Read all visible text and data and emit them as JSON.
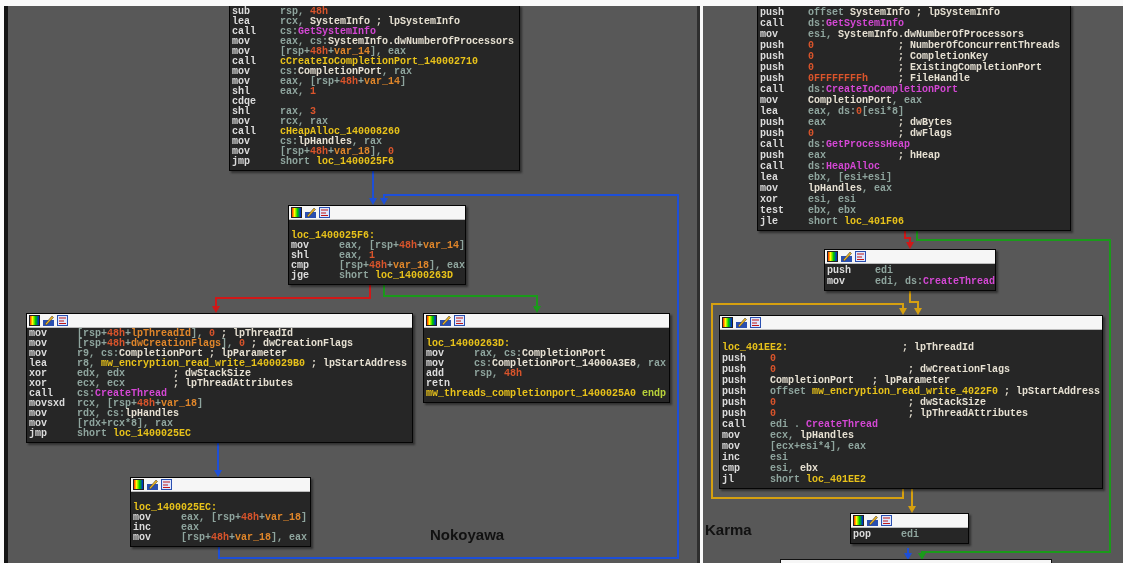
{
  "panels": [
    {
      "title": "Nokoyawa",
      "nodes": [
        {
          "header": false,
          "blank_line": false,
          "lines": [
            {
              "op": "sub",
              "args": [
                {
                  "text": "rsp, ",
                  "kind": "reg"
                },
                {
                  "text": "48h",
                  "kind": "num"
                }
              ]
            },
            {
              "op": "lea",
              "args": [
                {
                  "text": "rcx, ",
                  "kind": "reg"
                },
                {
                  "text": "SystemInfo ; lpSystemInfo",
                  "kind": "name"
                }
              ]
            },
            {
              "op": "call",
              "args": [
                {
                  "text": "cs:",
                  "kind": "reg"
                },
                {
                  "text": "GetSystemInfo",
                  "kind": "func"
                }
              ]
            },
            {
              "op": "mov",
              "args": [
                {
                  "text": "eax, cs:",
                  "kind": "reg"
                },
                {
                  "text": "SystemInfo.dwNumberOfProcessors",
                  "kind": "name"
                }
              ]
            },
            {
              "op": "mov",
              "args": [
                {
                  "text": "[rsp+",
                  "kind": "reg"
                },
                {
                  "text": "48h",
                  "kind": "num"
                },
                {
                  "text": "+",
                  "kind": "reg"
                },
                {
                  "text": "var_14",
                  "kind": "var"
                },
                {
                  "text": "], eax",
                  "kind": "reg"
                }
              ]
            },
            {
              "op": "call",
              "args": [
                {
                  "text": "cCreateIoCompletionPort_140002710",
                  "kind": "label"
                }
              ]
            },
            {
              "op": "mov",
              "args": [
                {
                  "text": "cs:",
                  "kind": "reg"
                },
                {
                  "text": "CompletionPort",
                  "kind": "name"
                },
                {
                  "text": ", rax",
                  "kind": "reg"
                }
              ]
            },
            {
              "op": "mov",
              "args": [
                {
                  "text": "eax, [rsp+",
                  "kind": "reg"
                },
                {
                  "text": "48h",
                  "kind": "num"
                },
                {
                  "text": "+",
                  "kind": "reg"
                },
                {
                  "text": "var_14",
                  "kind": "var"
                },
                {
                  "text": "]",
                  "kind": "reg"
                }
              ]
            },
            {
              "op": "shl",
              "args": [
                {
                  "text": "eax, ",
                  "kind": "reg"
                },
                {
                  "text": "1",
                  "kind": "num"
                }
              ]
            },
            {
              "op": "cdqe"
            },
            {
              "op": "shl",
              "args": [
                {
                  "text": "rax, ",
                  "kind": "reg"
                },
                {
                  "text": "3",
                  "kind": "num"
                }
              ]
            },
            {
              "op": "mov",
              "args": [
                {
                  "text": "rcx, rax",
                  "kind": "reg"
                }
              ]
            },
            {
              "op": "call",
              "args": [
                {
                  "text": "cHeapAlloc_140008260",
                  "kind": "label"
                }
              ]
            },
            {
              "op": "mov",
              "args": [
                {
                  "text": "cs:",
                  "kind": "reg"
                },
                {
                  "text": "lpHandles",
                  "kind": "name"
                },
                {
                  "text": ", rax",
                  "kind": "reg"
                }
              ]
            },
            {
              "op": "mov",
              "args": [
                {
                  "text": "[rsp+",
                  "kind": "reg"
                },
                {
                  "text": "48h",
                  "kind": "num"
                },
                {
                  "text": "+",
                  "kind": "reg"
                },
                {
                  "text": "var_18",
                  "kind": "var"
                },
                {
                  "text": "], ",
                  "kind": "reg"
                },
                {
                  "text": "0",
                  "kind": "num"
                }
              ]
            },
            {
              "op": "jmp",
              "args": [
                {
                  "text": "short ",
                  "kind": "reg"
                },
                {
                  "text": "loc_1400025F6",
                  "kind": "label"
                }
              ]
            }
          ]
        },
        {
          "header": true,
          "blank_line": true,
          "lines": [
            {
              "args": [
                {
                  "text": "loc_1400025F6:",
                  "kind": "label"
                }
              ]
            },
            {
              "op": "mov",
              "args": [
                {
                  "text": "eax, [rsp+",
                  "kind": "reg"
                },
                {
                  "text": "48h",
                  "kind": "num"
                },
                {
                  "text": "+",
                  "kind": "reg"
                },
                {
                  "text": "var_14",
                  "kind": "var"
                },
                {
                  "text": "]",
                  "kind": "reg"
                }
              ]
            },
            {
              "op": "shl",
              "args": [
                {
                  "text": "eax, ",
                  "kind": "reg"
                },
                {
                  "text": "1",
                  "kind": "num"
                }
              ]
            },
            {
              "op": "cmp",
              "args": [
                {
                  "text": "[rsp+",
                  "kind": "reg"
                },
                {
                  "text": "48h",
                  "kind": "num"
                },
                {
                  "text": "+",
                  "kind": "reg"
                },
                {
                  "text": "var_18",
                  "kind": "var"
                },
                {
                  "text": "], eax",
                  "kind": "reg"
                }
              ]
            },
            {
              "op": "jge",
              "args": [
                {
                  "text": "short ",
                  "kind": "reg"
                },
                {
                  "text": "loc_14000263D",
                  "kind": "label"
                }
              ]
            }
          ]
        },
        {
          "header": true,
          "blank_line": false,
          "lines": [
            {
              "op": "mov",
              "args": [
                {
                  "text": "[rsp+",
                  "kind": "reg"
                },
                {
                  "text": "48h",
                  "kind": "num"
                },
                {
                  "text": "+",
                  "kind": "reg"
                },
                {
                  "text": "lpThreadId",
                  "kind": "var"
                },
                {
                  "text": "], ",
                  "kind": "reg"
                },
                {
                  "text": "0",
                  "kind": "num"
                },
                {
                  "text": " ; lpThreadId",
                  "kind": "name"
                }
              ]
            },
            {
              "op": "mov",
              "args": [
                {
                  "text": "[rsp+",
                  "kind": "reg"
                },
                {
                  "text": "48h",
                  "kind": "num"
                },
                {
                  "text": "+",
                  "kind": "reg"
                },
                {
                  "text": "dwCreationFlags",
                  "kind": "var"
                },
                {
                  "text": "], ",
                  "kind": "reg"
                },
                {
                  "text": "0",
                  "kind": "num"
                },
                {
                  "text": " ; dwCreationFlags",
                  "kind": "name"
                }
              ]
            },
            {
              "op": "mov",
              "args": [
                {
                  "text": "r9, cs:",
                  "kind": "reg"
                },
                {
                  "text": "CompletionPort ; lpParameter",
                  "kind": "name"
                }
              ]
            },
            {
              "op": "lea",
              "args": [
                {
                  "text": "r8, ",
                  "kind": "reg"
                },
                {
                  "text": "mw_encryption_read_write_1400029B0",
                  "kind": "label"
                },
                {
                  "text": " ; lpStartAddress",
                  "kind": "name"
                }
              ]
            },
            {
              "op": "xor",
              "args": [
                {
                  "text": "edx, edx",
                  "kind": "reg"
                },
                {
                  "text": "        ; dwStackSize",
                  "kind": "name"
                }
              ]
            },
            {
              "op": "xor",
              "args": [
                {
                  "text": "ecx, ecx",
                  "kind": "reg"
                },
                {
                  "text": "        ; lpThreadAttributes",
                  "kind": "name"
                }
              ]
            },
            {
              "op": "call",
              "args": [
                {
                  "text": "cs:",
                  "kind": "reg"
                },
                {
                  "text": "CreateThread",
                  "kind": "func"
                }
              ]
            },
            {
              "op": "movsxd",
              "args": [
                {
                  "text": "rcx, [rsp+",
                  "kind": "reg"
                },
                {
                  "text": "48h",
                  "kind": "num"
                },
                {
                  "text": "+",
                  "kind": "reg"
                },
                {
                  "text": "var_18",
                  "kind": "var"
                },
                {
                  "text": "]",
                  "kind": "reg"
                }
              ]
            },
            {
              "op": "mov",
              "args": [
                {
                  "text": "rdx, cs:",
                  "kind": "reg"
                },
                {
                  "text": "lpHandles",
                  "kind": "name"
                }
              ]
            },
            {
              "op": "mov",
              "args": [
                {
                  "text": "[rdx+rcx*8], rax",
                  "kind": "reg"
                }
              ]
            },
            {
              "op": "jmp",
              "args": [
                {
                  "text": "short ",
                  "kind": "reg"
                },
                {
                  "text": "loc_1400025EC",
                  "kind": "label"
                }
              ]
            }
          ]
        },
        {
          "header": true,
          "blank_line": true,
          "lines": [
            {
              "args": [
                {
                  "text": "loc_14000263D:",
                  "kind": "label"
                }
              ]
            },
            {
              "op": "mov",
              "args": [
                {
                  "text": "rax, cs:",
                  "kind": "reg"
                },
                {
                  "text": "CompletionPort",
                  "kind": "name"
                }
              ]
            },
            {
              "op": "mov",
              "args": [
                {
                  "text": "cs:",
                  "kind": "reg"
                },
                {
                  "text": "CompletionPort_14000A3E8",
                  "kind": "name"
                },
                {
                  "text": ", rax",
                  "kind": "reg"
                }
              ]
            },
            {
              "op": "add",
              "args": [
                {
                  "text": "rsp, ",
                  "kind": "reg"
                },
                {
                  "text": "48h",
                  "kind": "num"
                }
              ]
            },
            {
              "op": "retn"
            },
            {
              "args": [
                {
                  "text": "mw_threads_completionport_1400025A0",
                  "kind": "label"
                },
                {
                  "text": " endp",
                  "kind": "endp"
                }
              ]
            }
          ]
        },
        {
          "header": true,
          "blank_line": true,
          "lines": [
            {
              "args": [
                {
                  "text": "loc_1400025EC:",
                  "kind": "label"
                }
              ]
            },
            {
              "op": "mov",
              "args": [
                {
                  "text": "eax, [rsp+",
                  "kind": "reg"
                },
                {
                  "text": "48h",
                  "kind": "num"
                },
                {
                  "text": "+",
                  "kind": "reg"
                },
                {
                  "text": "var_18",
                  "kind": "var"
                },
                {
                  "text": "]",
                  "kind": "reg"
                }
              ]
            },
            {
              "op": "inc",
              "args": [
                {
                  "text": "eax",
                  "kind": "reg"
                }
              ]
            },
            {
              "op": "mov",
              "args": [
                {
                  "text": "[rsp+",
                  "kind": "reg"
                },
                {
                  "text": "48h",
                  "kind": "num"
                },
                {
                  "text": "+",
                  "kind": "reg"
                },
                {
                  "text": "var_18",
                  "kind": "var"
                },
                {
                  "text": "], eax",
                  "kind": "reg"
                }
              ]
            }
          ]
        }
      ]
    },
    {
      "title": "Karma",
      "nodes": [
        {
          "header": false,
          "blank_line": false,
          "lines": [
            {
              "op": "push",
              "args": [
                {
                  "text": "offset ",
                  "kind": "reg"
                },
                {
                  "text": "SystemInfo ; lpSystemInfo",
                  "kind": "name"
                }
              ]
            },
            {
              "op": "call",
              "args": [
                {
                  "text": "ds:",
                  "kind": "reg"
                },
                {
                  "text": "GetSystemInfo",
                  "kind": "func"
                }
              ]
            },
            {
              "op": "mov",
              "args": [
                {
                  "text": "esi, ",
                  "kind": "reg"
                },
                {
                  "text": "SystemInfo.dwNumberOfProcessors",
                  "kind": "name"
                }
              ]
            },
            {
              "op": "push",
              "args": [
                {
                  "text": "0",
                  "kind": "num"
                },
                {
                  "text": "              ; NumberOfConcurrentThreads",
                  "kind": "name"
                }
              ]
            },
            {
              "op": "push",
              "args": [
                {
                  "text": "0",
                  "kind": "num"
                },
                {
                  "text": "              ; CompletionKey",
                  "kind": "name"
                }
              ]
            },
            {
              "op": "push",
              "args": [
                {
                  "text": "0",
                  "kind": "num"
                },
                {
                  "text": "              ; ExistingCompletionPort",
                  "kind": "name"
                }
              ]
            },
            {
              "op": "push",
              "args": [
                {
                  "text": "0FFFFFFFFh",
                  "kind": "num"
                },
                {
                  "text": "     ; FileHandle",
                  "kind": "name"
                }
              ]
            },
            {
              "op": "call",
              "args": [
                {
                  "text": "ds:",
                  "kind": "reg"
                },
                {
                  "text": "CreateIoCompletionPort",
                  "kind": "func"
                }
              ]
            },
            {
              "op": "mov",
              "args": [
                {
                  "text": "CompletionPort",
                  "kind": "name"
                },
                {
                  "text": ", eax",
                  "kind": "reg"
                }
              ]
            },
            {
              "op": "lea",
              "args": [
                {
                  "text": "eax, ds:",
                  "kind": "reg"
                },
                {
                  "text": "0",
                  "kind": "num"
                },
                {
                  "text": "[esi*8]",
                  "kind": "reg"
                }
              ]
            },
            {
              "op": "push",
              "args": [
                {
                  "text": "eax",
                  "kind": "reg"
                },
                {
                  "text": "            ; dwBytes",
                  "kind": "name"
                }
              ]
            },
            {
              "op": "push",
              "args": [
                {
                  "text": "0",
                  "kind": "num"
                },
                {
                  "text": "              ; dwFlags",
                  "kind": "name"
                }
              ]
            },
            {
              "op": "call",
              "args": [
                {
                  "text": "ds:",
                  "kind": "reg"
                },
                {
                  "text": "GetProcessHeap",
                  "kind": "func"
                }
              ]
            },
            {
              "op": "push",
              "args": [
                {
                  "text": "eax",
                  "kind": "reg"
                },
                {
                  "text": "            ; hHeap",
                  "kind": "name"
                }
              ]
            },
            {
              "op": "call",
              "args": [
                {
                  "text": "ds:",
                  "kind": "reg"
                },
                {
                  "text": "HeapAlloc",
                  "kind": "func"
                }
              ]
            },
            {
              "op": "lea",
              "args": [
                {
                  "text": "ebx, [esi+esi]",
                  "kind": "reg"
                }
              ]
            },
            {
              "op": "mov",
              "args": [
                {
                  "text": "lpHandles",
                  "kind": "name"
                },
                {
                  "text": ", eax",
                  "kind": "reg"
                }
              ]
            },
            {
              "op": "xor",
              "args": [
                {
                  "text": "esi, esi",
                  "kind": "reg"
                }
              ]
            },
            {
              "op": "test",
              "args": [
                {
                  "text": "ebx, ebx",
                  "kind": "reg"
                }
              ]
            },
            {
              "op": "jle",
              "args": [
                {
                  "text": "short ",
                  "kind": "reg"
                },
                {
                  "text": "loc_401F06",
                  "kind": "label"
                }
              ]
            }
          ]
        },
        {
          "header": true,
          "blank_line": false,
          "lines": [
            {
              "op": "push",
              "args": [
                {
                  "text": "edi",
                  "kind": "reg"
                }
              ]
            },
            {
              "op": "mov",
              "args": [
                {
                  "text": "edi, ds:",
                  "kind": "reg"
                },
                {
                  "text": "CreateThread",
                  "kind": "func"
                }
              ]
            }
          ]
        },
        {
          "header": true,
          "blank_line": true,
          "lines": [
            {
              "args": [
                {
                  "text": "loc_401EE2:",
                  "kind": "label"
                },
                {
                  "text": "                   ; lpThreadId",
                  "kind": "name"
                }
              ]
            },
            {
              "op": "push",
              "args": [
                {
                  "text": "0",
                  "kind": "num"
                }
              ]
            },
            {
              "op": "push",
              "args": [
                {
                  "text": "0",
                  "kind": "num"
                },
                {
                  "text": "                      ; dwCreationFlags",
                  "kind": "name"
                }
              ]
            },
            {
              "op": "push",
              "args": [
                {
                  "text": "CompletionPort   ; lpParameter",
                  "kind": "name"
                }
              ]
            },
            {
              "op": "push",
              "args": [
                {
                  "text": "offset ",
                  "kind": "reg"
                },
                {
                  "text": "mw_encryption_read_write_4022F0",
                  "kind": "label"
                },
                {
                  "text": " ; lpStartAddress",
                  "kind": "name"
                }
              ]
            },
            {
              "op": "push",
              "args": [
                {
                  "text": "0",
                  "kind": "num"
                },
                {
                  "text": "                      ; dwStackSize",
                  "kind": "name"
                }
              ]
            },
            {
              "op": "push",
              "args": [
                {
                  "text": "0",
                  "kind": "num"
                },
                {
                  "text": "                      ; lpThreadAttributes",
                  "kind": "name"
                }
              ]
            },
            {
              "op": "call",
              "args": [
                {
                  "text": "edi . ",
                  "kind": "reg"
                },
                {
                  "text": "CreateThread",
                  "kind": "func"
                }
              ]
            },
            {
              "op": "mov",
              "args": [
                {
                  "text": "ecx, ",
                  "kind": "reg"
                },
                {
                  "text": "lpHandles",
                  "kind": "name"
                }
              ]
            },
            {
              "op": "mov",
              "args": [
                {
                  "text": "[ecx+esi*4], eax",
                  "kind": "reg"
                }
              ]
            },
            {
              "op": "inc",
              "args": [
                {
                  "text": "esi",
                  "kind": "reg"
                }
              ]
            },
            {
              "op": "cmp",
              "args": [
                {
                  "text": "esi, ",
                  "kind": "reg"
                },
                {
                  "text": "ebx",
                  "kind": "name"
                }
              ]
            },
            {
              "op": "jl",
              "args": [
                {
                  "text": "short ",
                  "kind": "reg"
                },
                {
                  "text": "loc_401EE2",
                  "kind": "label"
                }
              ]
            }
          ]
        },
        {
          "header": true,
          "blank_line": false,
          "lines": [
            {
              "op": "pop",
              "args": [
                {
                  "text": "edi",
                  "kind": "reg"
                }
              ]
            }
          ]
        }
      ]
    }
  ]
}
